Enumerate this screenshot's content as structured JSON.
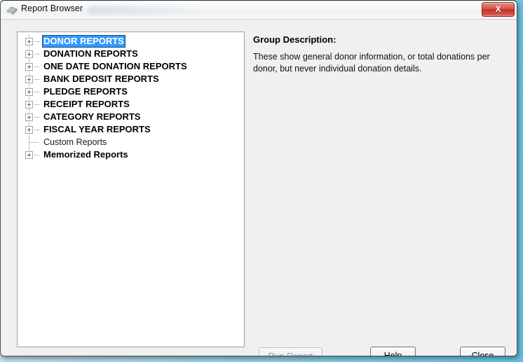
{
  "window": {
    "title": "Report Browser",
    "icon": "report-stack-icon",
    "close_label": "X"
  },
  "tree": {
    "items": [
      {
        "label": "DONOR REPORTS",
        "expandable": true,
        "bold": true,
        "selected": true
      },
      {
        "label": "DONATION REPORTS",
        "expandable": true,
        "bold": true,
        "selected": false
      },
      {
        "label": "ONE DATE DONATION REPORTS",
        "expandable": true,
        "bold": true,
        "selected": false
      },
      {
        "label": "BANK DEPOSIT REPORTS",
        "expandable": true,
        "bold": true,
        "selected": false
      },
      {
        "label": "PLEDGE REPORTS",
        "expandable": true,
        "bold": true,
        "selected": false
      },
      {
        "label": "RECEIPT REPORTS",
        "expandable": true,
        "bold": true,
        "selected": false
      },
      {
        "label": "CATEGORY REPORTS",
        "expandable": true,
        "bold": true,
        "selected": false
      },
      {
        "label": "FISCAL YEAR REPORTS",
        "expandable": true,
        "bold": true,
        "selected": false
      },
      {
        "label": "Custom Reports",
        "expandable": false,
        "bold": false,
        "selected": false
      },
      {
        "label": "Memorized Reports",
        "expandable": true,
        "bold": true,
        "selected": false
      }
    ]
  },
  "description": {
    "heading": "Group Description:",
    "body": "These show general donor information, or total donations per donor, but never individual donation details."
  },
  "buttons": {
    "run_report": {
      "label": "Run Report",
      "mnemonic": "R",
      "enabled": false
    },
    "help": {
      "label": "Help",
      "mnemonic": "H",
      "enabled": true
    },
    "close": {
      "label": "Close",
      "mnemonic": "C",
      "enabled": true
    }
  },
  "colors": {
    "selection": "#3399ff",
    "dialog_background": "#f0f0f0",
    "tree_background": "#ffffff",
    "close_button": "#c32f26"
  }
}
